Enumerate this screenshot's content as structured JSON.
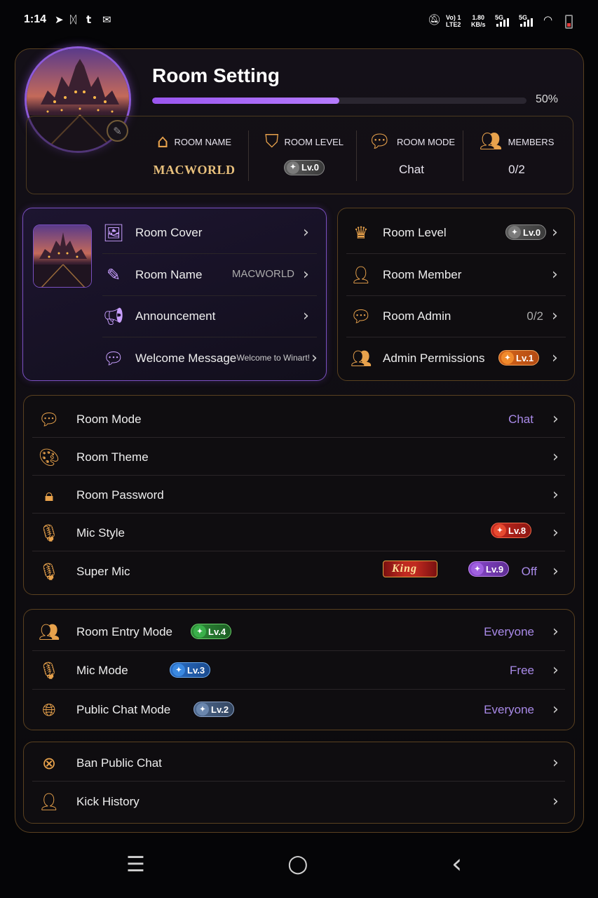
{
  "status_bar": {
    "time": "1:14",
    "network_1": "Vo) 1\nLTE2",
    "speed": "1.80\nKB/s",
    "net_5g_a": "5G",
    "net_5g_b": "5G"
  },
  "header": {
    "title": "Room Setting",
    "progress_percent": 50,
    "progress_text": "50%"
  },
  "info": {
    "room_name_label": "ROOM NAME",
    "room_name_value": "MACWORLD",
    "room_level_label": "ROOM LEVEL",
    "room_level_badge": "Lv.0",
    "room_mode_label": "ROOM MODE",
    "room_mode_value": "Chat",
    "members_label": "MEMBERS",
    "members_value": "0/2"
  },
  "left_panel": {
    "items": [
      {
        "label": "Room Cover",
        "value": ""
      },
      {
        "label": "Room Name",
        "value": "MACWORLD"
      },
      {
        "label": "Announcement",
        "value": ""
      },
      {
        "label": "Welcome Message",
        "value": "Welcome to Winart!"
      }
    ]
  },
  "right_panel": {
    "items": [
      {
        "label": "Room Level",
        "badge": "Lv.0"
      },
      {
        "label": "Room Member",
        "value": ""
      },
      {
        "label": "Room Admin",
        "value": "0/2"
      },
      {
        "label": "Admin Permissions",
        "badge": "Lv.1"
      }
    ]
  },
  "mode_panel": {
    "items": [
      {
        "label": "Room Mode",
        "value": "Chat"
      },
      {
        "label": "Room Theme",
        "value": ""
      },
      {
        "label": "Room Password",
        "value": ""
      },
      {
        "label": "Mic Style",
        "badge": "Lv.8"
      },
      {
        "label": "Super Mic",
        "king_badge": "King",
        "badge": "Lv.9",
        "value": "Off"
      }
    ]
  },
  "entry_panel": {
    "items": [
      {
        "label": "Room Entry Mode",
        "badge": "Lv.4",
        "value": "Everyone"
      },
      {
        "label": "Mic Mode",
        "badge": "Lv.3",
        "value": "Free"
      },
      {
        "label": "Public Chat Mode",
        "badge": "Lv.2",
        "value": "Everyone"
      }
    ]
  },
  "ban_panel": {
    "items": [
      {
        "label": "Ban Public Chat"
      },
      {
        "label": "Kick History"
      }
    ]
  },
  "icons": {
    "edit": "pencil-icon",
    "home": "house-icon",
    "shield": "shield-icon",
    "chat": "chat-bubble-icon",
    "members": "people-icon",
    "image": "image-icon",
    "announce": "megaphone-icon",
    "crown": "crown-icon",
    "user": "user-icon",
    "palette": "palette-icon",
    "lock": "lock-icon",
    "mic": "microphone-icon",
    "globe": "globe-icon",
    "ban": "ban-icon",
    "kick": "user-clock-icon",
    "nav_menu": "menu-icon",
    "nav_home": "home-circle-icon",
    "nav_back": "back-icon"
  },
  "colors": {
    "accent_purple": "#9a56ef",
    "accent_gold": "#e8a24c",
    "background": "#050507"
  }
}
